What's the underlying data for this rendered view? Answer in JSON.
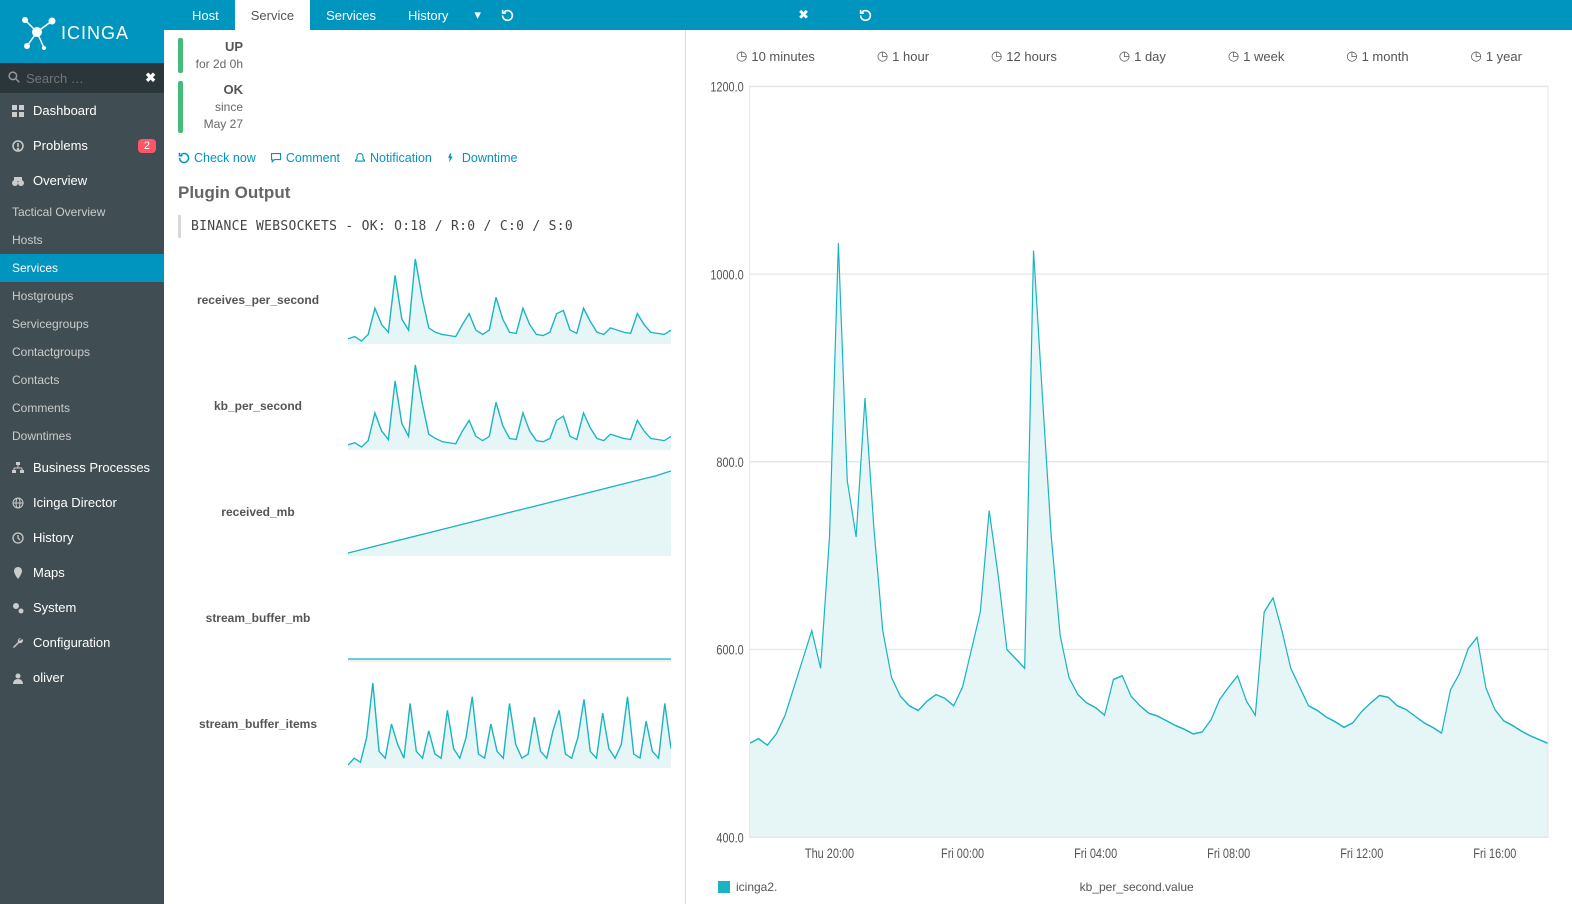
{
  "brand": "ICINGA",
  "search": {
    "placeholder": "Search …"
  },
  "sidebar": {
    "dashboard": "Dashboard",
    "problems": "Problems",
    "problems_badge": "2",
    "overview": "Overview",
    "sub": {
      "tactical": "Tactical Overview",
      "hosts": "Hosts",
      "services": "Services",
      "hostgroups": "Hostgroups",
      "servicegroups": "Servicegroups",
      "contactgroups": "Contactgroups",
      "contacts": "Contacts",
      "comments": "Comments",
      "downtimes": "Downtimes"
    },
    "business": "Business Processes",
    "director": "Icinga Director",
    "history": "History",
    "maps": "Maps",
    "system": "System",
    "configuration": "Configuration",
    "user": "oliver"
  },
  "tabs": {
    "host": "Host",
    "service": "Service",
    "services": "Services",
    "history": "History"
  },
  "service": {
    "up_state": "UP",
    "up_since": "for 2d 0h",
    "ok_state": "OK",
    "ok_since": "since May 27",
    "cmd_check": "Check now",
    "cmd_comment": "Comment",
    "cmd_notification": "Notification",
    "cmd_downtime": "Downtime",
    "section_title": "Plugin Output",
    "plugin_output": "BINANCE WEBSOCKETS - OK: O:18 / R:0 / C:0 / S:0",
    "metrics": {
      "m0": "receives_per_second",
      "m1": "kb_per_second",
      "m2": "received_mb",
      "m3": "stream_buffer_mb",
      "m4": "stream_buffer_items"
    }
  },
  "ranges": {
    "r0": "10 minutes",
    "r1": "1 hour",
    "r2": "12 hours",
    "r3": "1 day",
    "r4": "1 week",
    "r5": "1 month",
    "r6": "1 year"
  },
  "chart": {
    "legend_series": "icinga2.",
    "axis_title": "kb_per_second.value"
  },
  "chart_data": {
    "type": "line",
    "title": "kb_per_second.value",
    "ylim": [
      400,
      1200
    ],
    "yticks": [
      400,
      600,
      800,
      1000,
      1200
    ],
    "x_labels": [
      "Thu 20:00",
      "Fri 00:00",
      "Fri 04:00",
      "Fri 08:00",
      "Fri 12:00",
      "Fri 16:00"
    ],
    "series": [
      {
        "name": "icinga2.",
        "color": "#1ab4c0",
        "values": [
          500,
          505,
          498,
          510,
          530,
          560,
          590,
          620,
          580,
          720,
          1033,
          780,
          720,
          868,
          730,
          620,
          570,
          550,
          540,
          535,
          545,
          552,
          548,
          540,
          560,
          600,
          640,
          748,
          680,
          600,
          590,
          580,
          1025,
          870,
          720,
          615,
          570,
          552,
          543,
          538,
          530,
          568,
          572,
          550,
          540,
          532,
          529,
          524,
          519,
          515,
          510,
          512,
          525,
          547,
          560,
          572,
          545,
          530,
          640,
          655,
          620,
          580,
          560,
          540,
          535,
          528,
          523,
          517,
          522,
          534,
          543,
          551,
          549,
          540,
          536,
          529,
          522,
          517,
          511,
          557,
          574,
          601,
          613,
          559,
          536,
          524,
          519,
          513,
          508,
          504,
          500
        ]
      }
    ]
  },
  "mini_charts": [
    {
      "name": "receives_per_second",
      "type": "line",
      "values": [
        22,
        24,
        20,
        26,
        50,
        35,
        28,
        80,
        40,
        30,
        95,
        60,
        32,
        28,
        26,
        25,
        24,
        35,
        45,
        30,
        26,
        30,
        60,
        40,
        28,
        27,
        50,
        35,
        26,
        25,
        28,
        45,
        48,
        30,
        27,
        50,
        38,
        28,
        26,
        32,
        30,
        28,
        27,
        45,
        35,
        28,
        27,
        26,
        30
      ]
    },
    {
      "name": "kb_per_second",
      "type": "line",
      "values": [
        25,
        27,
        23,
        29,
        55,
        38,
        30,
        85,
        45,
        33,
        100,
        65,
        35,
        31,
        28,
        27,
        26,
        38,
        48,
        33,
        29,
        33,
        65,
        43,
        31,
        30,
        55,
        38,
        29,
        28,
        31,
        48,
        52,
        33,
        30,
        55,
        41,
        31,
        29,
        35,
        33,
        31,
        30,
        48,
        38,
        31,
        30,
        29,
        33
      ]
    },
    {
      "name": "received_mb",
      "type": "area",
      "values": [
        10,
        14,
        18,
        22,
        26,
        30,
        34,
        38,
        42,
        46,
        50,
        54,
        58,
        62,
        66,
        70,
        74,
        78,
        82,
        86,
        90,
        95
      ]
    },
    {
      "name": "stream_buffer_mb",
      "type": "line",
      "values": [
        50,
        50,
        50,
        50,
        50,
        50,
        50,
        50,
        50,
        50,
        50,
        50,
        50,
        50,
        50,
        50,
        50,
        50,
        50,
        50
      ]
    },
    {
      "name": "stream_buffer_items",
      "type": "line",
      "values": [
        10,
        15,
        12,
        30,
        70,
        20,
        15,
        40,
        25,
        15,
        55,
        20,
        15,
        35,
        18,
        15,
        50,
        22,
        15,
        30,
        60,
        18,
        15,
        40,
        20,
        15,
        55,
        25,
        15,
        18,
        45,
        20,
        15,
        35,
        50,
        18,
        15,
        30,
        58,
        20,
        15,
        48,
        22,
        15,
        25,
        60,
        18,
        15,
        42,
        20,
        15,
        55,
        22
      ]
    }
  ]
}
